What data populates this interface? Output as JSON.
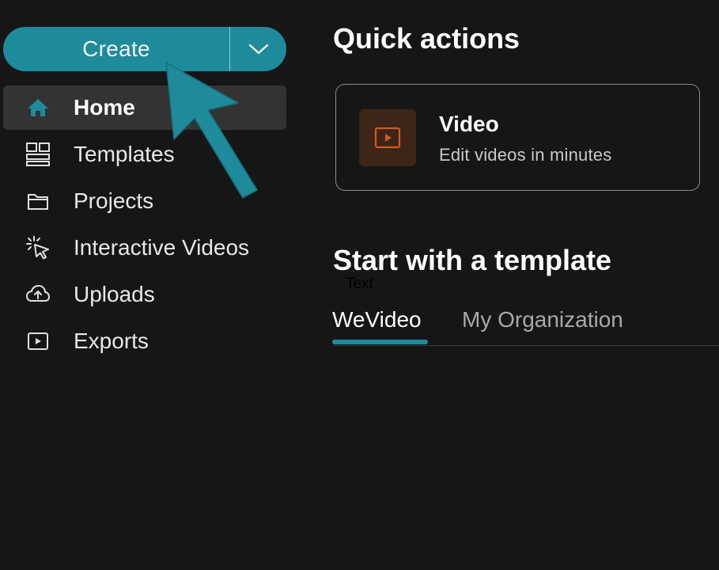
{
  "create_button": {
    "label": "Create",
    "caret_icon": "chevron-down-icon",
    "color": "#1e8b9b"
  },
  "sidebar": {
    "items": [
      {
        "label": "Home",
        "icon": "home-icon",
        "active": true
      },
      {
        "label": "Templates",
        "icon": "templates-icon",
        "active": false
      },
      {
        "label": "Projects",
        "icon": "folder-icon",
        "active": false
      },
      {
        "label": "Interactive Videos",
        "icon": "interactive-cursor-icon",
        "active": false
      },
      {
        "label": "Uploads",
        "icon": "cloud-upload-icon",
        "active": false
      },
      {
        "label": "Exports",
        "icon": "export-play-icon",
        "active": false
      }
    ]
  },
  "main": {
    "quick_actions_title": "Quick actions",
    "video_card": {
      "title": "Video",
      "subtitle": "Edit videos in minutes",
      "icon": "video-play-icon",
      "accent": "#d35a1f"
    },
    "templates_title": "Start with a template",
    "overlay_text": "Text",
    "tabs": [
      {
        "label": "WeVideo",
        "active": true
      },
      {
        "label": "My Organization",
        "active": false
      }
    ]
  },
  "annotation": {
    "type": "arrow",
    "color": "#1e8b9b"
  }
}
